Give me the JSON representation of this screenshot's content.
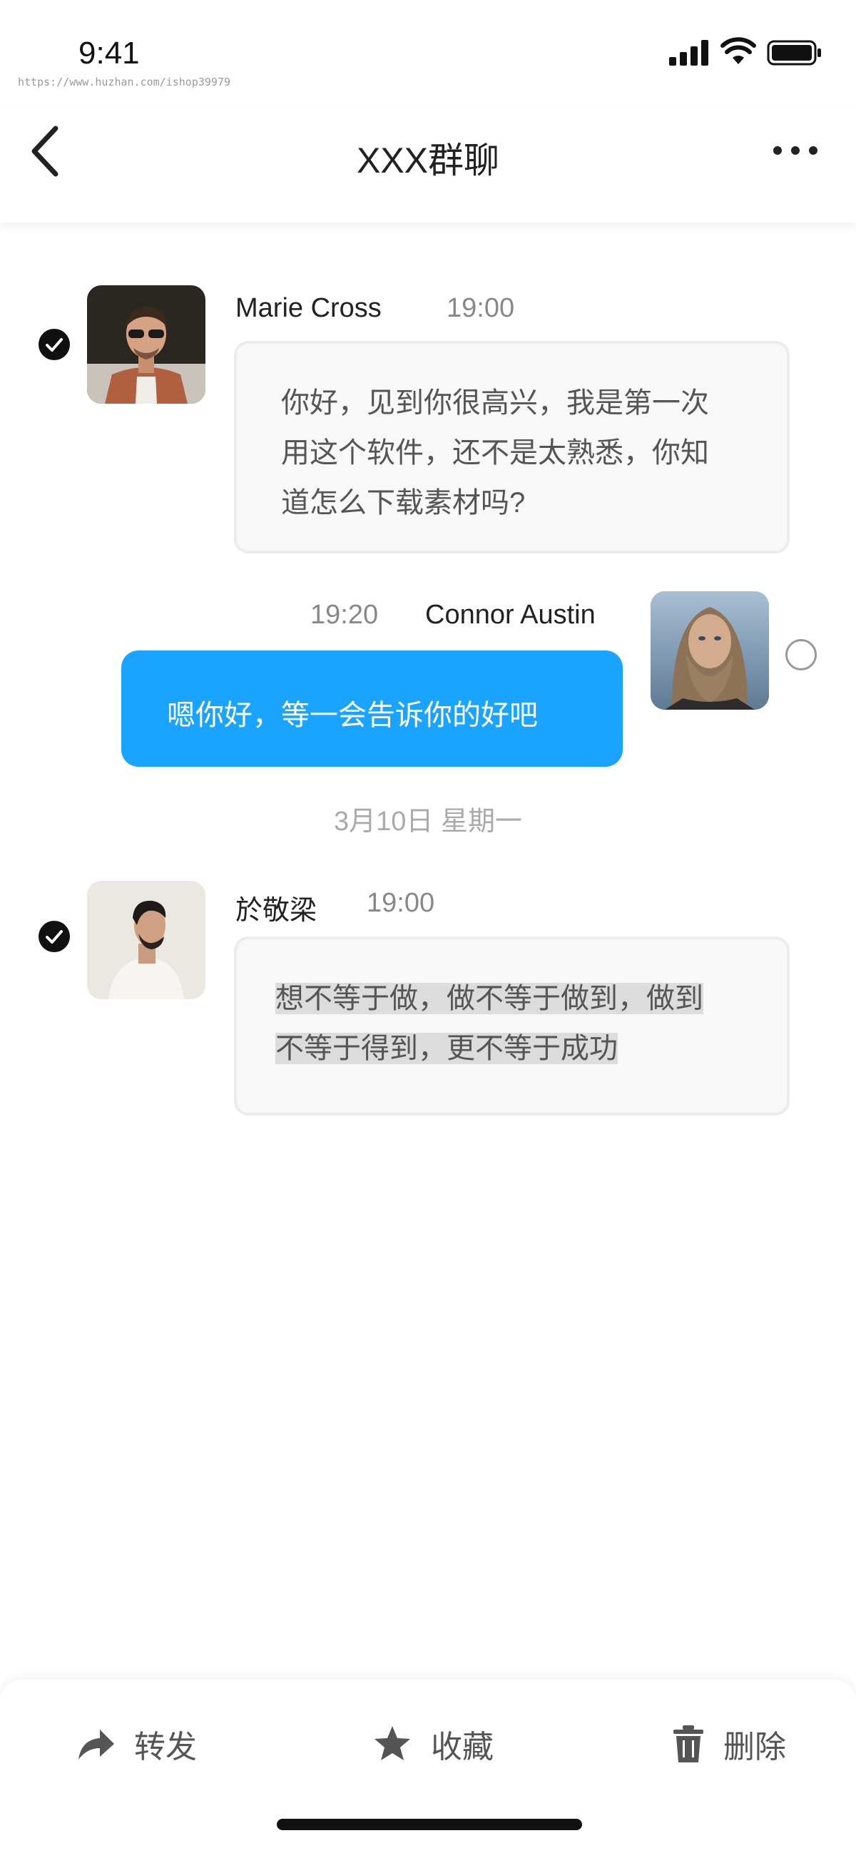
{
  "status_bar": {
    "time": "9:41",
    "watermark": "https://www.huzhan.com/ishop39979"
  },
  "header": {
    "title": "XXX群聊"
  },
  "messages": [
    {
      "sender": "Marie Cross",
      "time": "19:00",
      "lines": [
        "你好，见到你很高兴，我是第一次",
        "用这个软件，还不是太熟悉，你知",
        "道怎么下载素材吗?"
      ],
      "selected": true
    },
    {
      "sender": "Connor Austin",
      "time": "19:20",
      "text": "嗯你好，等一会告诉你的好吧",
      "selected": false
    },
    {
      "sender": "於敬梁",
      "time": "19:00",
      "lines": [
        "想不等于做，做不等于做到，做到",
        "不等于得到，更不等于成功"
      ],
      "selected": true
    }
  ],
  "date_separator": "3月10日  星期一",
  "bottom_actions": {
    "forward": "转发",
    "favorite": "收藏",
    "delete": "删除"
  },
  "colors": {
    "accent": "#1aa3ff",
    "incoming_bubble": "#f8f8f8",
    "check_selected": "#111111"
  }
}
